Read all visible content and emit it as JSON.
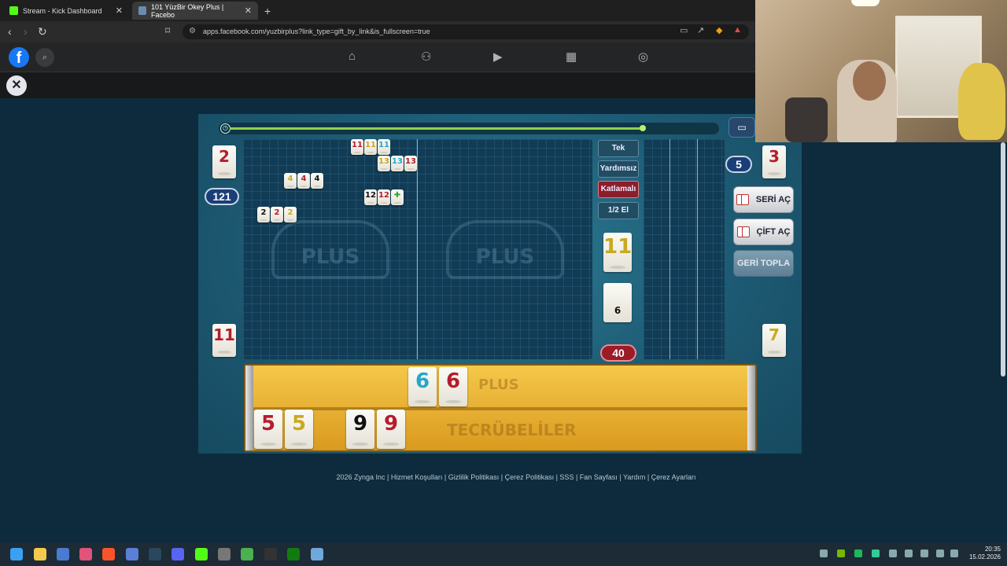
{
  "browser": {
    "tabs": [
      {
        "label": "Stream - Kick Dashboard",
        "icon": "kick-icon",
        "color": "#53fc18"
      },
      {
        "label": "101 YüzBir Okey Plus | Facebo",
        "icon": "game-icon",
        "color": "#6a8caf"
      }
    ],
    "url": "apps.facebook.com/yuzbirplus?link_type=gift_by_link&is_fullscreen=true"
  },
  "game": {
    "timer_progress": 0.87,
    "mode_buttons": [
      {
        "label": "Tek",
        "active": false
      },
      {
        "label": "Yardımsız",
        "active": false
      },
      {
        "label": "Katlamalı",
        "active": true
      },
      {
        "label": "1/2 El",
        "active": false
      }
    ],
    "players": {
      "left_top_tile": "2",
      "left_score": "121",
      "left_bottom_tile": "11",
      "right_badge": "5",
      "right_top_tile": "3",
      "right_bottom_tile": "7"
    },
    "indicator_tile": "11",
    "remaining_count": "6",
    "points_badge": "40",
    "actions": [
      {
        "label": "SERİ AÇ",
        "enabled": true
      },
      {
        "label": "ÇİFT AÇ",
        "enabled": true
      },
      {
        "label": "GERİ TOPLA",
        "enabled": false
      }
    ],
    "board_groups": [
      {
        "tiles": [
          {
            "v": "11",
            "c": "red"
          },
          {
            "v": "11",
            "c": "yellow"
          },
          {
            "v": "11",
            "c": "blue"
          }
        ]
      },
      {
        "tiles": [
          {
            "v": "13",
            "c": "yellow"
          },
          {
            "v": "13",
            "c": "blue"
          },
          {
            "v": "13",
            "c": "red"
          }
        ]
      },
      {
        "tiles": [
          {
            "v": "4",
            "c": "yellow"
          },
          {
            "v": "4",
            "c": "red"
          },
          {
            "v": "4",
            "c": "black"
          }
        ]
      },
      {
        "tiles": [
          {
            "v": "12",
            "c": "black"
          },
          {
            "v": "12",
            "c": "red"
          },
          {
            "v": "✚",
            "c": "green"
          }
        ]
      },
      {
        "tiles": [
          {
            "v": "2",
            "c": "black"
          },
          {
            "v": "2",
            "c": "red"
          },
          {
            "v": "2",
            "c": "yellow"
          }
        ]
      }
    ],
    "rack_top": [
      {
        "v": "6",
        "c": "blue"
      },
      {
        "v": "6",
        "c": "red"
      }
    ],
    "rack_bottom_left": [
      {
        "v": "5",
        "c": "red"
      },
      {
        "v": "5",
        "c": "yellow"
      }
    ],
    "rack_bottom_mid": [
      {
        "v": "9",
        "c": "black"
      },
      {
        "v": "9",
        "c": "red"
      }
    ],
    "watermark_text": "PLUS",
    "rack_label": "TECRÜBELİLER"
  },
  "footer": "2026 Zynga Inc | Hizmet Koşulları | Gizlilik Politikası | Çerez Politikası | SSS | Fan Sayfası | Yardım | Çerez Ayarları",
  "taskbar": {
    "time": "20:35",
    "date": "15.02.2026"
  },
  "colors": {
    "tile_red": "#b51d2c",
    "tile_yellow": "#c9a921",
    "tile_blue": "#27a6c9",
    "tile_black": "#111111",
    "tile_green": "#31a534",
    "facebook_blue": "#1877f2"
  }
}
